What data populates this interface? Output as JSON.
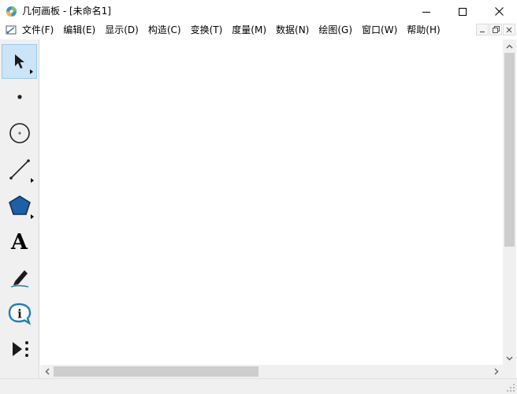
{
  "window": {
    "title": "几何画板 - [未命名1]",
    "icons": {
      "app": "geometer-sketchpad-icon",
      "doc": "document-icon",
      "minimize": "minimize-icon",
      "maximize": "maximize-icon",
      "close": "close-icon"
    }
  },
  "menu": {
    "items": [
      {
        "label": "文件(F)"
      },
      {
        "label": "编辑(E)"
      },
      {
        "label": "显示(D)"
      },
      {
        "label": "构造(C)"
      },
      {
        "label": "变换(T)"
      },
      {
        "label": "度量(M)"
      },
      {
        "label": "数据(N)"
      },
      {
        "label": "绘图(G)"
      },
      {
        "label": "窗口(W)"
      },
      {
        "label": "帮助(H)"
      }
    ]
  },
  "toolbox": {
    "tools": [
      {
        "name": "selection-arrow-tool",
        "icon": "arrow-icon",
        "selected": true
      },
      {
        "name": "point-tool",
        "icon": "point-icon",
        "selected": false
      },
      {
        "name": "compass-tool",
        "icon": "circle-icon",
        "selected": false
      },
      {
        "name": "straightedge-tool",
        "icon": "segment-icon",
        "selected": false
      },
      {
        "name": "polygon-tool",
        "icon": "polygon-icon",
        "selected": false
      },
      {
        "name": "text-tool",
        "icon": "text-icon",
        "glyph": "A",
        "selected": false
      },
      {
        "name": "marker-tool",
        "icon": "marker-icon",
        "selected": false
      },
      {
        "name": "information-tool",
        "icon": "info-icon",
        "glyph": "i",
        "selected": false
      },
      {
        "name": "custom-tool",
        "icon": "custom-tool-icon",
        "selected": false
      }
    ]
  },
  "colors": {
    "selected_tool_bg": "#cce4f7",
    "polygon_fill": "#1f5fa6",
    "info_icon": "#1e7fb6"
  },
  "scrollbars": {
    "vertical_thumb_fraction": 0.65,
    "horizontal_thumb_fraction": 0.47
  }
}
